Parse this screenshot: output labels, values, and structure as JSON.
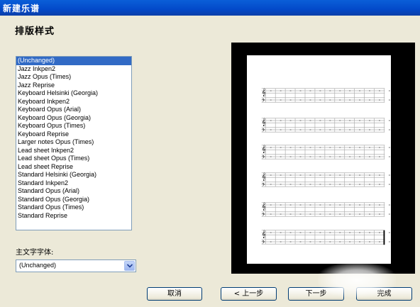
{
  "window": {
    "title": "新建乐谱"
  },
  "page": {
    "heading": "排版样式"
  },
  "style_list": {
    "items": [
      "(Unchanged)",
      "Jazz Inkpen2",
      "Jazz Opus (Times)",
      "Jazz Reprise",
      "Keyboard Helsinki (Georgia)",
      "Keyboard Inkpen2",
      "Keyboard Opus (Arial)",
      "Keyboard Opus (Georgia)",
      "Keyboard Opus (Times)",
      "Keyboard Reprise",
      "Larger notes Opus (Times)",
      "Lead sheet Inkpen2",
      "Lead sheet Opus (Times)",
      "Lead sheet Reprise",
      "Standard Helsinki (Georgia)",
      "Standard Inkpen2",
      "Standard Opus (Arial)",
      "Standard Opus (Georgia)",
      "Standard Opus (Times)",
      "Standard Reprise"
    ],
    "selected": "(Unchanged)"
  },
  "main_font": {
    "label": "主文字字体:",
    "value": "(Unchanged)"
  },
  "buttons": {
    "cancel": "取消",
    "back": "< 上一步",
    "next": "下一步",
    "finish": "完成"
  },
  "icons": {
    "dropdown": "chevron-down-icon",
    "clef": "treble-clef-icon"
  }
}
